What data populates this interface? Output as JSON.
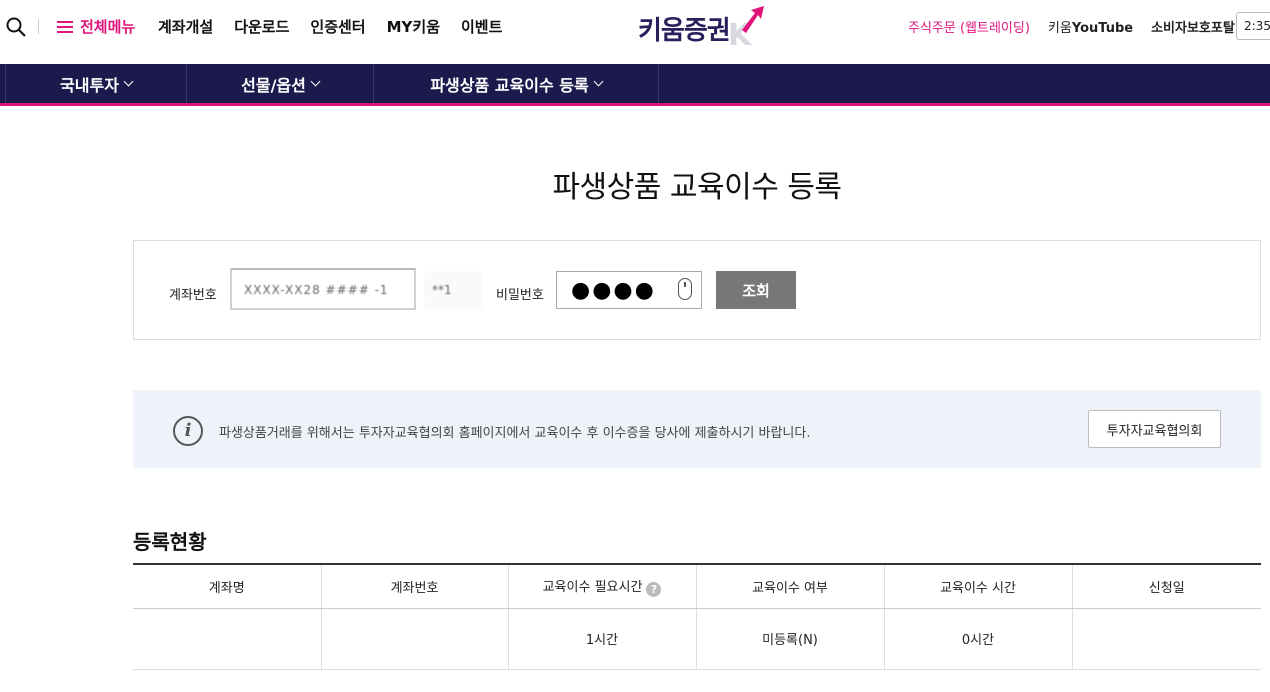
{
  "header": {
    "menu_all_label": "전체메뉴",
    "nav": [
      "계좌개설",
      "다운로드",
      "인증센터",
      "MY키움",
      "이벤트"
    ],
    "logo_text": "키움증권",
    "logo_k": "K",
    "links": {
      "web_trading": "주식주문 (웹트레이딩)",
      "youtube_prefix": "키움",
      "youtube_brand": "YouTube",
      "consumer_portal": "소비자보호포탈"
    },
    "clock": "2:35"
  },
  "navbar": {
    "items": [
      "국내투자",
      "선물/옵션",
      "파생상품 교육이수 등록"
    ]
  },
  "page": {
    "title": "파생상품 교육이수 등록"
  },
  "form": {
    "account_label": "계좌번호",
    "account_value": "XXXX-XX28 #### -1",
    "account_sub": "**1",
    "password_label": "비밀번호",
    "password_value": "●●●●",
    "search_button": "조회"
  },
  "info": {
    "message": "파생상품거래를 위해서는 투자자교육협의회 홈페이지에서 교육이수 후 이수증을 당사에 제출하시기 바랍니다.",
    "button": "투자자교육협의회"
  },
  "status": {
    "title": "등록현황",
    "columns": [
      "계좌명",
      "계좌번호",
      "교육이수 필요시간",
      "교육이수 여부",
      "교육이수 시간",
      "신청일"
    ],
    "rows": [
      [
        "",
        "",
        "1시간",
        "미등록(N)",
        "0시간",
        ""
      ]
    ]
  },
  "colors": {
    "brand_pink": "#e0157c",
    "navy": "#1c1a4d",
    "button_gray": "#777777",
    "info_bg": "#eef3fa"
  }
}
